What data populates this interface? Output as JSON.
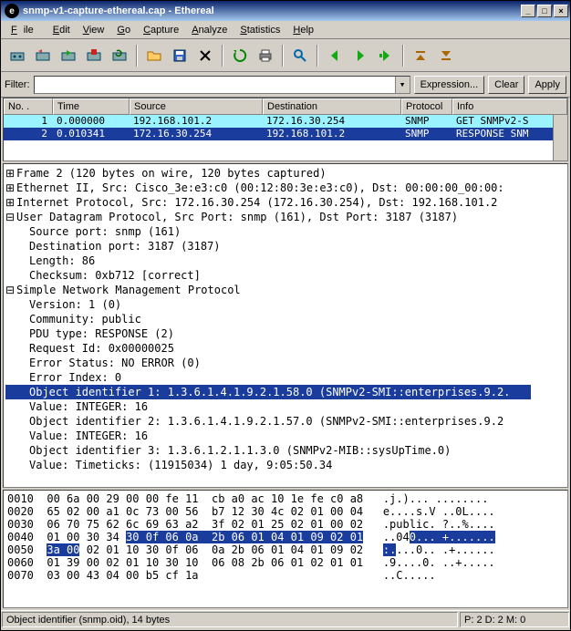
{
  "window": {
    "title": "snmp-v1-capture-ethereal.cap - Ethereal"
  },
  "menu": [
    "File",
    "Edit",
    "View",
    "Go",
    "Capture",
    "Analyze",
    "Statistics",
    "Help"
  ],
  "filter": {
    "label": "Filter:",
    "value": "",
    "expression": "Expression...",
    "clear": "Clear",
    "apply": "Apply"
  },
  "columns": {
    "no": "No. .",
    "time": "Time",
    "source": "Source",
    "destination": "Destination",
    "protocol": "Protocol",
    "info": "Info"
  },
  "packets": [
    {
      "no": "1",
      "time": "0.000000",
      "src": "192.168.101.2",
      "dst": "172.16.30.254",
      "proto": "SNMP",
      "info": "GET SNMPv2-S"
    },
    {
      "no": "2",
      "time": "0.010341",
      "src": "172.16.30.254",
      "dst": "192.168.101.2",
      "proto": "SNMP",
      "info": "RESPONSE SNM"
    }
  ],
  "tree": {
    "frame": "Frame 2 (120 bytes on wire, 120 bytes captured)",
    "eth": "Ethernet II, Src: Cisco_3e:e3:c0 (00:12:80:3e:e3:c0), Dst: 00:00:00_00:00:",
    "ip": "Internet Protocol, Src: 172.16.30.254 (172.16.30.254), Dst: 192.168.101.2",
    "udp": "User Datagram Protocol, Src Port: snmp (161), Dst Port: 3187 (3187)",
    "udp_children": [
      "Source port: snmp (161)",
      "Destination port: 3187 (3187)",
      "Length: 86",
      "Checksum: 0xb712 [correct]"
    ],
    "snmp": "Simple Network Management Protocol",
    "snmp_children": [
      "Version: 1 (0)",
      "Community: public",
      "PDU type: RESPONSE (2)",
      "Request Id: 0x00000025",
      "Error Status: NO ERROR (0)",
      "Error Index: 0",
      "Object identifier 1: 1.3.6.1.4.1.9.2.1.58.0 (SNMPv2-SMI::enterprises.9.2.",
      "Value: INTEGER: 16",
      "Object identifier 2: 1.3.6.1.4.1.9.2.1.57.0 (SNMPv2-SMI::enterprises.9.2",
      "Value: INTEGER: 16",
      "Object identifier 3: 1.3.6.1.2.1.1.3.0 (SNMPv2-MIB::sysUpTime.0)",
      "Value: Timeticks: (11915034) 1 day, 9:05:50.34"
    ],
    "highlight_index": 6
  },
  "hex": [
    {
      "off": "0010",
      "b": "00 6a 00 29 00 00 fe 11  cb a0 ac 10 1e fe c0 a8",
      "a": ".j.)... ........"
    },
    {
      "off": "0020",
      "b": "65 02 00 a1 0c 73 00 56  b7 12 30 4c 02 01 00 04",
      "a": "e....s.V ..0L...."
    },
    {
      "off": "0030",
      "b": "06 70 75 62 6c 69 63 a2  3f 02 01 25 02 01 00 02",
      "a": ".public. ?..%...."
    },
    {
      "off": "0040",
      "b1": "01 00 30 34 ",
      "bh": "30 0f 06 0a  2b 06 01 04 01 09 02 01",
      "a1": "..04",
      "ah": "0... +......."
    },
    {
      "off": "0050",
      "bh2": "3a 00",
      "b2": " 02 01 10 30 0f 06  0a 2b 06 01 04 01 09 02",
      "ah2": ":.",
      "a2": "...0.. .+......"
    },
    {
      "off": "0060",
      "b": "01 39 00 02 01 10 30 10  06 08 2b 06 01 02 01 01",
      "a": ".9....0. ..+....."
    },
    {
      "off": "0070",
      "b": "03 00 43 04 00 b5 cf 1a                         ",
      "a": "..C..... "
    }
  ],
  "status": {
    "left": "Object identifier (snmp.oid), 14 bytes",
    "right": "P: 2 D: 2 M: 0"
  }
}
